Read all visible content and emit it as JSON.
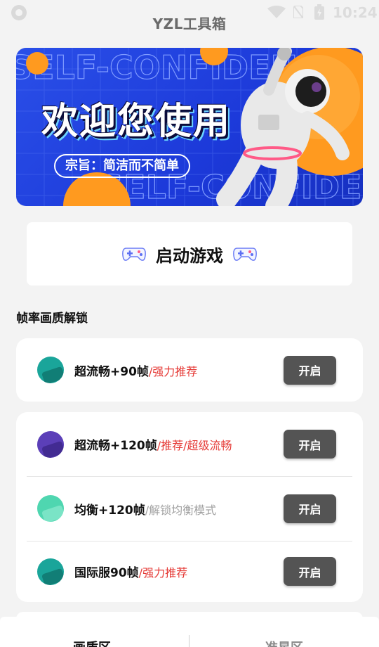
{
  "status_bar": {
    "time": "10:24",
    "icons": [
      "app-indicator-icon",
      "wifi-icon",
      "no-sim-icon",
      "battery-charging-icon"
    ]
  },
  "app": {
    "title": "YZL工具箱"
  },
  "banner": {
    "headline": "欢迎您使用",
    "slogan": "宗旨：简洁而不简单",
    "background_text": "SELF-CONFIDENCE",
    "image": "astronaut",
    "colors": {
      "background": "#1c39d9",
      "accent": "#ff9a1f"
    }
  },
  "launch": {
    "label": "启动游戏",
    "icon": "gamepad-icon"
  },
  "section": {
    "title": "帧率画质解锁"
  },
  "options_card1": [
    {
      "title": "超流畅+90帧",
      "tag": "/强力推荐",
      "tag_color": "red",
      "button": "开启",
      "icon_color": "#1aa59a"
    }
  ],
  "options_card2": [
    {
      "title": "超流畅+120帧",
      "tag": "/推荐/超级流畅",
      "tag_color": "red",
      "button": "开启",
      "icon_color": "#5b3fb8"
    },
    {
      "title": "均衡+120帧",
      "tag": "/解锁均衡模式",
      "tag_color": "gray",
      "button": "开启",
      "icon_color": "#4fd6b0"
    },
    {
      "title": "国际服90帧",
      "tag": "/强力推荐",
      "tag_color": "red",
      "button": "开启",
      "icon_color": "#1aa59a"
    }
  ],
  "tabs": [
    {
      "label": "画质区",
      "active": true
    },
    {
      "label": "准星区",
      "active": false
    }
  ],
  "colors": {
    "button": "#545454",
    "tag_red": "#e53935",
    "tag_gray": "#a0a0a0"
  }
}
